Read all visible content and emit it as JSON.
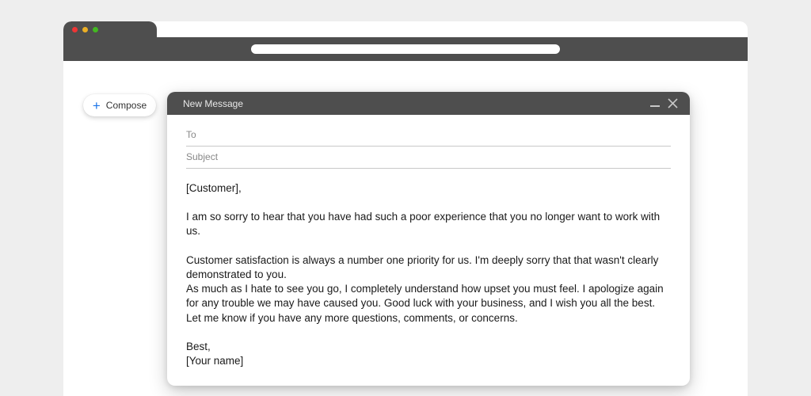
{
  "compose_button": {
    "label": "Compose"
  },
  "compose_window": {
    "title": "New Message",
    "to_label": "To",
    "subject_label": "Subject",
    "body": {
      "greeting": "[Customer],",
      "p1": "I am so sorry to hear that you have had such a poor experience that you no longer want to work with us.",
      "p2": "Customer satisfaction is always a number one priority for us. I'm deeply sorry that that wasn't clearly demonstrated to you.",
      "p3": "As much as I hate to see you go, I completely understand how upset you must feel. I apologize again for any trouble we may have caused you. Good luck with your business, and I wish you all the best. Let me know if you have any more questions, comments, or concerns.",
      "signoff": "Best,",
      "signature": "[Your name]"
    }
  }
}
